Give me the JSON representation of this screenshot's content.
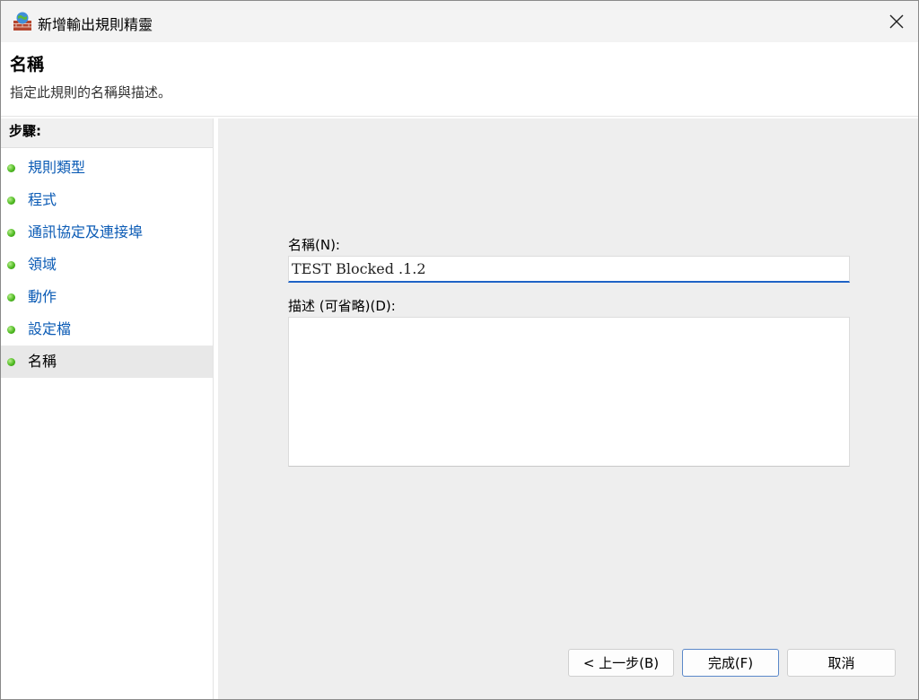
{
  "window": {
    "title": "新增輸出規則精靈"
  },
  "header": {
    "title": "名稱",
    "subtitle": "指定此規則的名稱與描述。"
  },
  "steps": {
    "heading": "步驟:",
    "items": [
      {
        "label": "規則類型",
        "active": false
      },
      {
        "label": "程式",
        "active": false
      },
      {
        "label": "通訊協定及連接埠",
        "active": false
      },
      {
        "label": "領域",
        "active": false
      },
      {
        "label": "動作",
        "active": false
      },
      {
        "label": "設定檔",
        "active": false
      },
      {
        "label": "名稱",
        "active": true
      }
    ]
  },
  "form": {
    "name_label": "名稱(N):",
    "name_value": "TEST Blocked .1.2",
    "desc_label": "描述 (可省略)(D):",
    "desc_value": ""
  },
  "buttons": {
    "back": "< 上一步(B)",
    "finish": "完成(F)",
    "cancel": "取消"
  },
  "colors": {
    "link": "#0b5bb5",
    "focus": "#1f63c6",
    "status_dot": "#4fba22"
  }
}
